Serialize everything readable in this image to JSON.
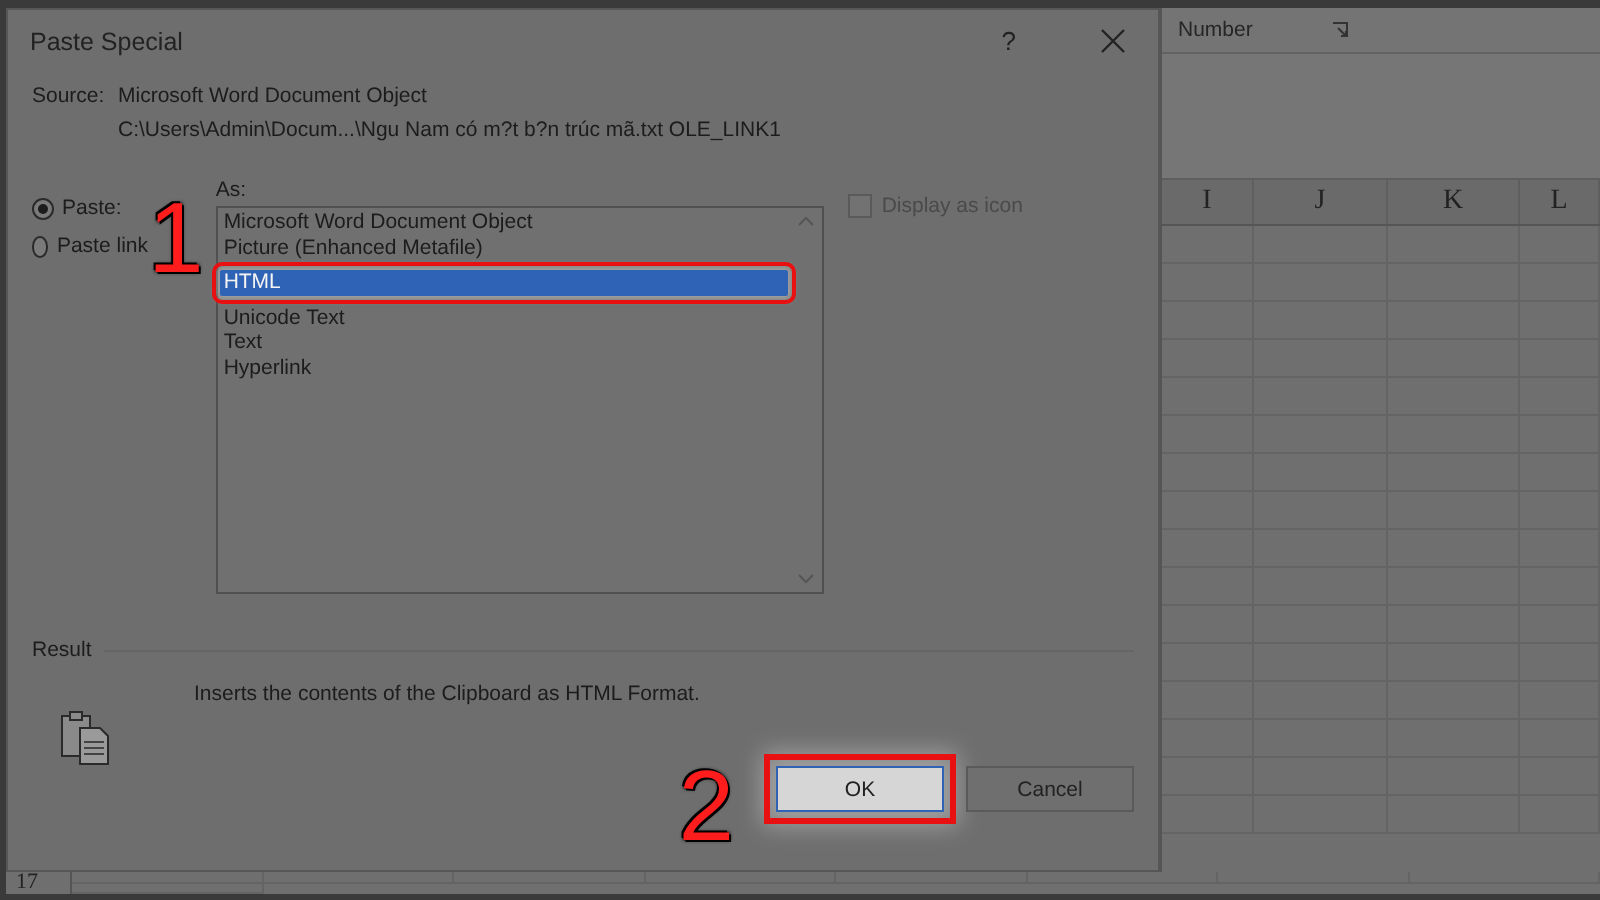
{
  "window": {
    "title": "Paste Special",
    "help": "?"
  },
  "source": {
    "label": "Source:",
    "name": "Microsoft Word Document Object",
    "path": "C:\\Users\\Admin\\Docum...\\Ngu Nam có m?t b?n trúc mã.txt OLE_LINK1"
  },
  "paste_options": [
    {
      "label": "Paste:",
      "selected": true
    },
    {
      "label": "Paste link",
      "selected": false
    }
  ],
  "as_label": "As:",
  "formats": [
    {
      "label": "Microsoft Word Document Object",
      "selected": false
    },
    {
      "label": "Picture (Enhanced Metafile)",
      "selected": false
    },
    {
      "label": "HTML",
      "selected": true
    },
    {
      "label": "Unicode Text",
      "selected": false
    },
    {
      "label": "Text",
      "selected": false
    },
    {
      "label": "Hyperlink",
      "selected": false
    }
  ],
  "display_as_icon": {
    "label": "Display as icon",
    "checked": false
  },
  "result": {
    "label": "Result",
    "text": "Inserts the contents of the Clipboard as HTML Format."
  },
  "buttons": [
    {
      "label": "OK",
      "kind": "highlighted"
    },
    {
      "label": "Cancel",
      "kind": "plain"
    }
  ],
  "annotations": [
    {
      "label": "1"
    },
    {
      "label": "2"
    }
  ],
  "spreadsheet": {
    "group_label": "Number",
    "columns": [
      "I",
      "J",
      "K",
      "L"
    ],
    "row_label": "17"
  }
}
